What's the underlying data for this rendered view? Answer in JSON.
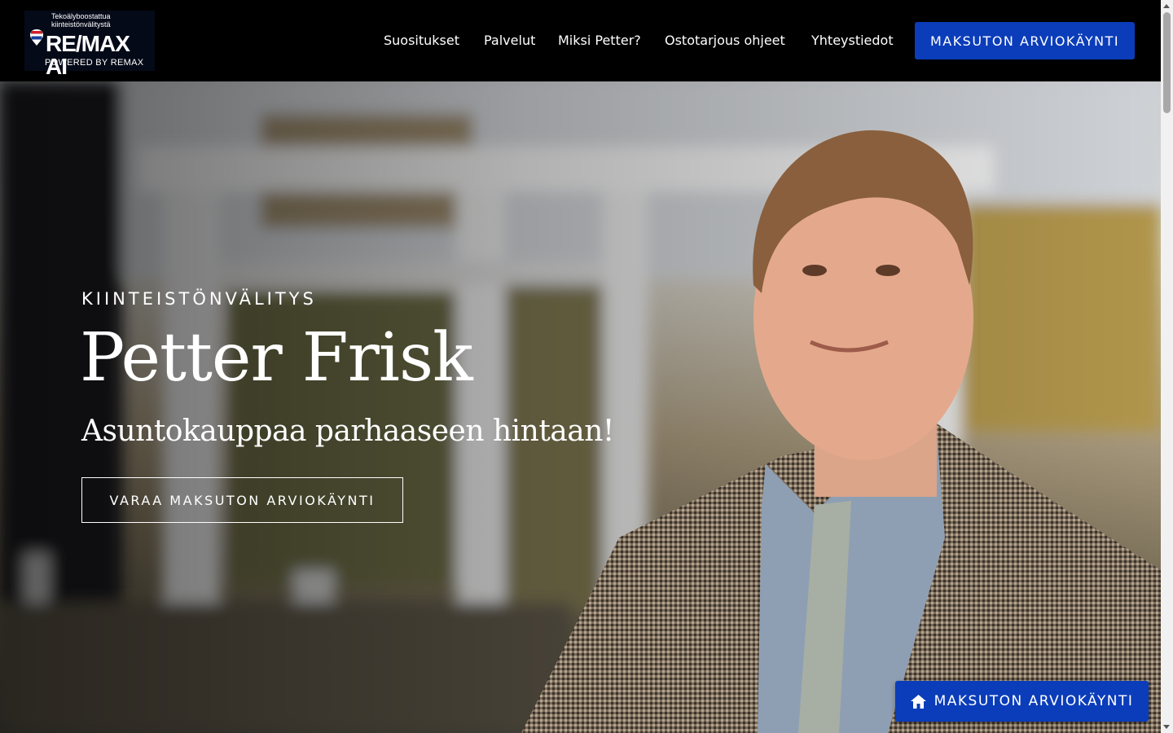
{
  "header": {
    "logo": {
      "tagline": "Tekoälyboostattua kiinteistönvälitystä",
      "wordmark": "RE/MAX AI",
      "powered_by": "POWERED BY REMAX"
    },
    "nav": [
      {
        "label": "Suositukset"
      },
      {
        "label": "Palvelut"
      },
      {
        "label": "Miksi Petter?"
      },
      {
        "label": "Ostotarjous ohjeet"
      },
      {
        "label": "Yhteystiedot"
      }
    ],
    "cta_label": "MAKSUTON ARVIOKÄYNTI"
  },
  "hero": {
    "kicker": "KIINTEISTÖNVÄLITYS",
    "name": "Petter Frisk",
    "subtitle": "Asuntokauppaa parhaaseen hintaan!",
    "button_label": "VARAA MAKSUTON ARVIOKÄYNTI",
    "photo_subject": "portrait of smiling man in houndstooth jacket"
  },
  "floating_cta": {
    "icon": "home-icon",
    "label": "MAKSUTON ARVIOKÄYNTI"
  },
  "colors": {
    "header_bg": "#000000",
    "accent": "#0b3dba",
    "text": "#ffffff"
  }
}
